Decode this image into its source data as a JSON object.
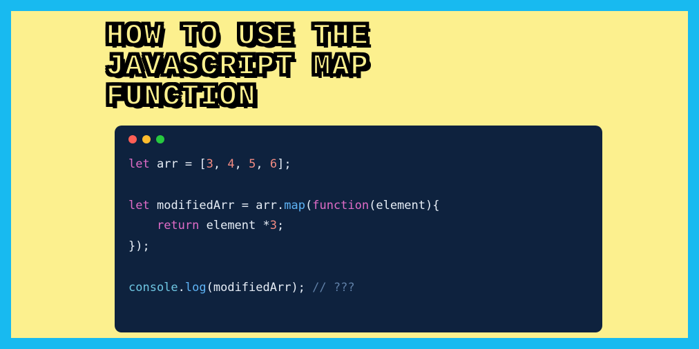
{
  "title_line1": "HOW TO USE THE",
  "title_line2": "JAVASCRIPT MAP",
  "title_line3": "FUNCTION",
  "window": {
    "icons": {
      "close": "close-icon",
      "min": "minimize-icon",
      "max": "maximize-icon"
    }
  },
  "code": {
    "l1": {
      "let": "let",
      "arr": "arr",
      "eq": " = [",
      "n1": "3",
      "c1": ", ",
      "n2": "4",
      "c2": ", ",
      "n3": "5",
      "c3": ", ",
      "n4": "6",
      "end": "];"
    },
    "l2": "",
    "l3": {
      "let": "let",
      "mod": "modifiedArr",
      "eq": " = ",
      "arr": "arr",
      "dot": ".",
      "map": "map",
      "open": "(",
      "fn": "function",
      "sig": "(element){"
    },
    "l4": {
      "indent": "    ",
      "ret": "return",
      "rest": " element *",
      "n": "3",
      "semi": ";"
    },
    "l5": {
      "close": "});"
    },
    "l6": "",
    "l7": {
      "console": "console",
      "dot": ".",
      "log": "log",
      "args": "(modifiedArr); ",
      "comment": "// ???"
    }
  }
}
